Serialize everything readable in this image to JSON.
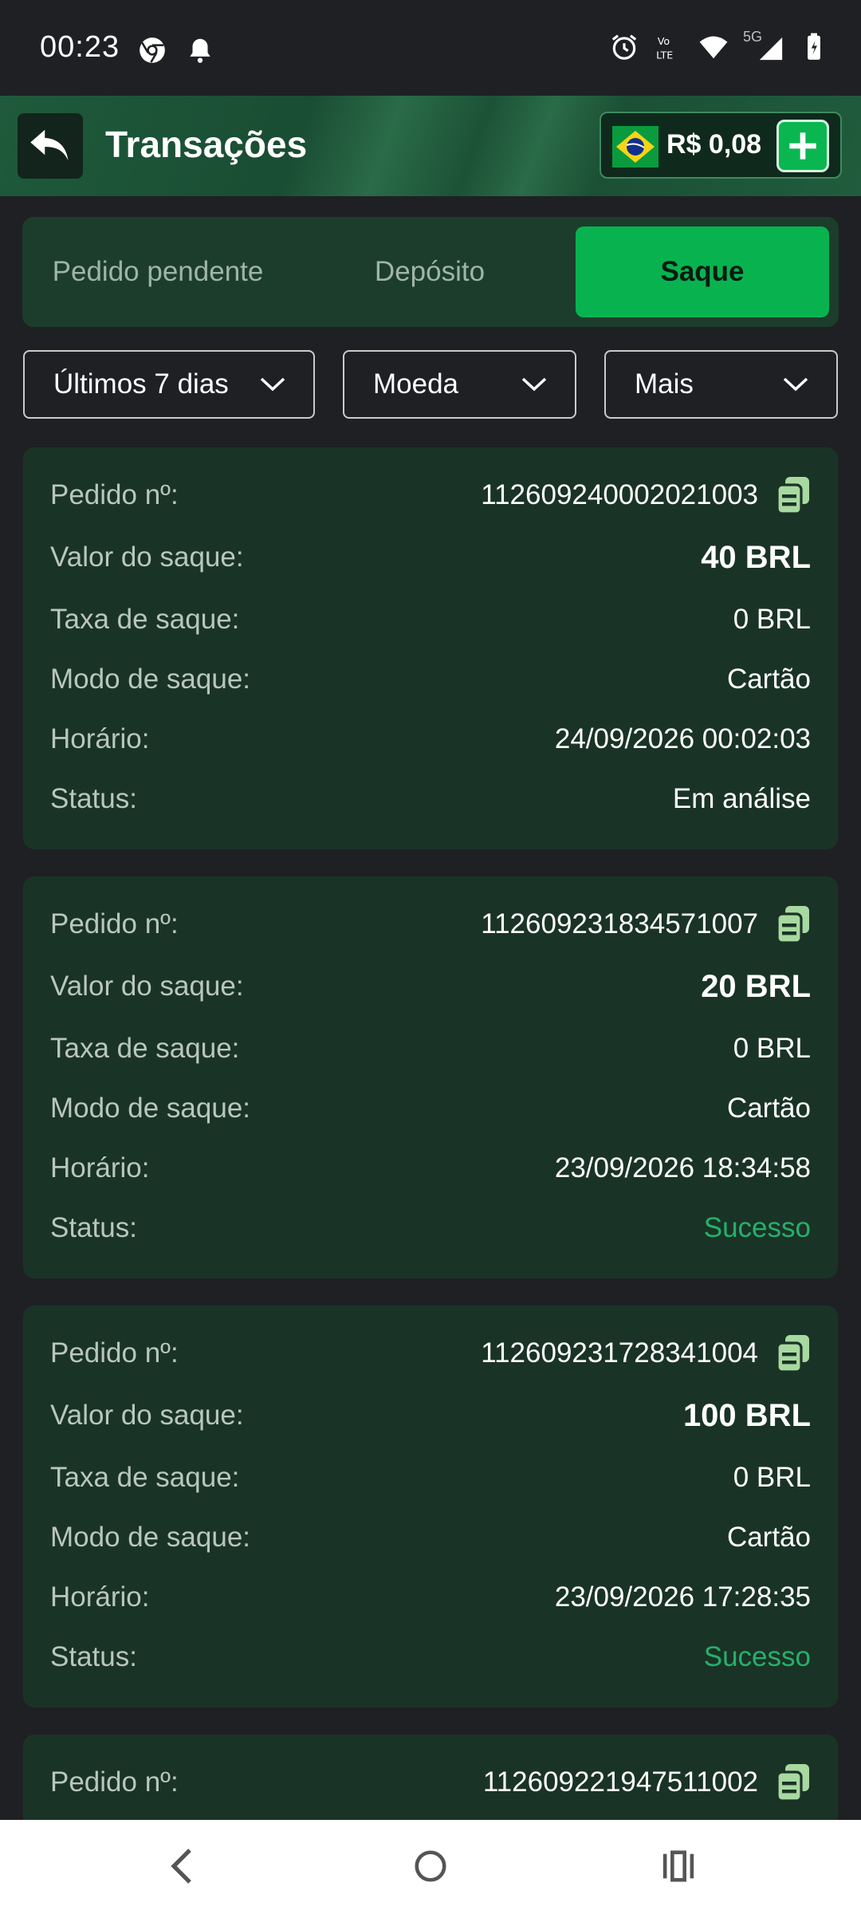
{
  "status_bar": {
    "time": "00:23",
    "icons": [
      "chrome-icon",
      "notification-bell-icon",
      "alarm-icon",
      "volte-icon",
      "wifi-icon",
      "signal-5g-icon",
      "battery-icon"
    ],
    "network": "5G"
  },
  "header": {
    "title": "Transações",
    "balance": "R$ 0,08",
    "icons": [
      "back-arrow-icon",
      "brazil-flag-icon",
      "plus-icon"
    ]
  },
  "tabs": [
    {
      "label": "Pedido pendente",
      "active": false
    },
    {
      "label": "Depósito",
      "active": false
    },
    {
      "label": "Saque",
      "active": true
    }
  ],
  "filters": {
    "period": "Últimos 7 dias",
    "currency": "Moeda",
    "more": "Mais"
  },
  "labels": {
    "order": "Pedido nº:",
    "amount": "Valor do saque:",
    "fee": "Taxa de saque:",
    "mode": "Modo de saque:",
    "time": "Horário:",
    "status": "Status:"
  },
  "transactions": [
    {
      "order_id": "112609240002021003",
      "amount": "40 BRL",
      "fee": "0 BRL",
      "mode": "Cartão",
      "time": "24/09/2026 00:02:03",
      "status": "Em análise"
    },
    {
      "order_id": "112609231834571007",
      "amount": "20 BRL",
      "fee": "0 BRL",
      "mode": "Cartão",
      "time": "23/09/2026 18:34:58",
      "status": "Sucesso"
    },
    {
      "order_id": "112609231728341004",
      "amount": "100 BRL",
      "fee": "0 BRL",
      "mode": "Cartão",
      "time": "23/09/2026 17:28:35",
      "status": "Sucesso"
    },
    {
      "order_id": "112609221947511002"
    }
  ],
  "colors": {
    "accent_green": "#08b34f",
    "success_text": "#26b06a",
    "card_bg": "#1a3327",
    "page_bg": "#1f2024"
  }
}
